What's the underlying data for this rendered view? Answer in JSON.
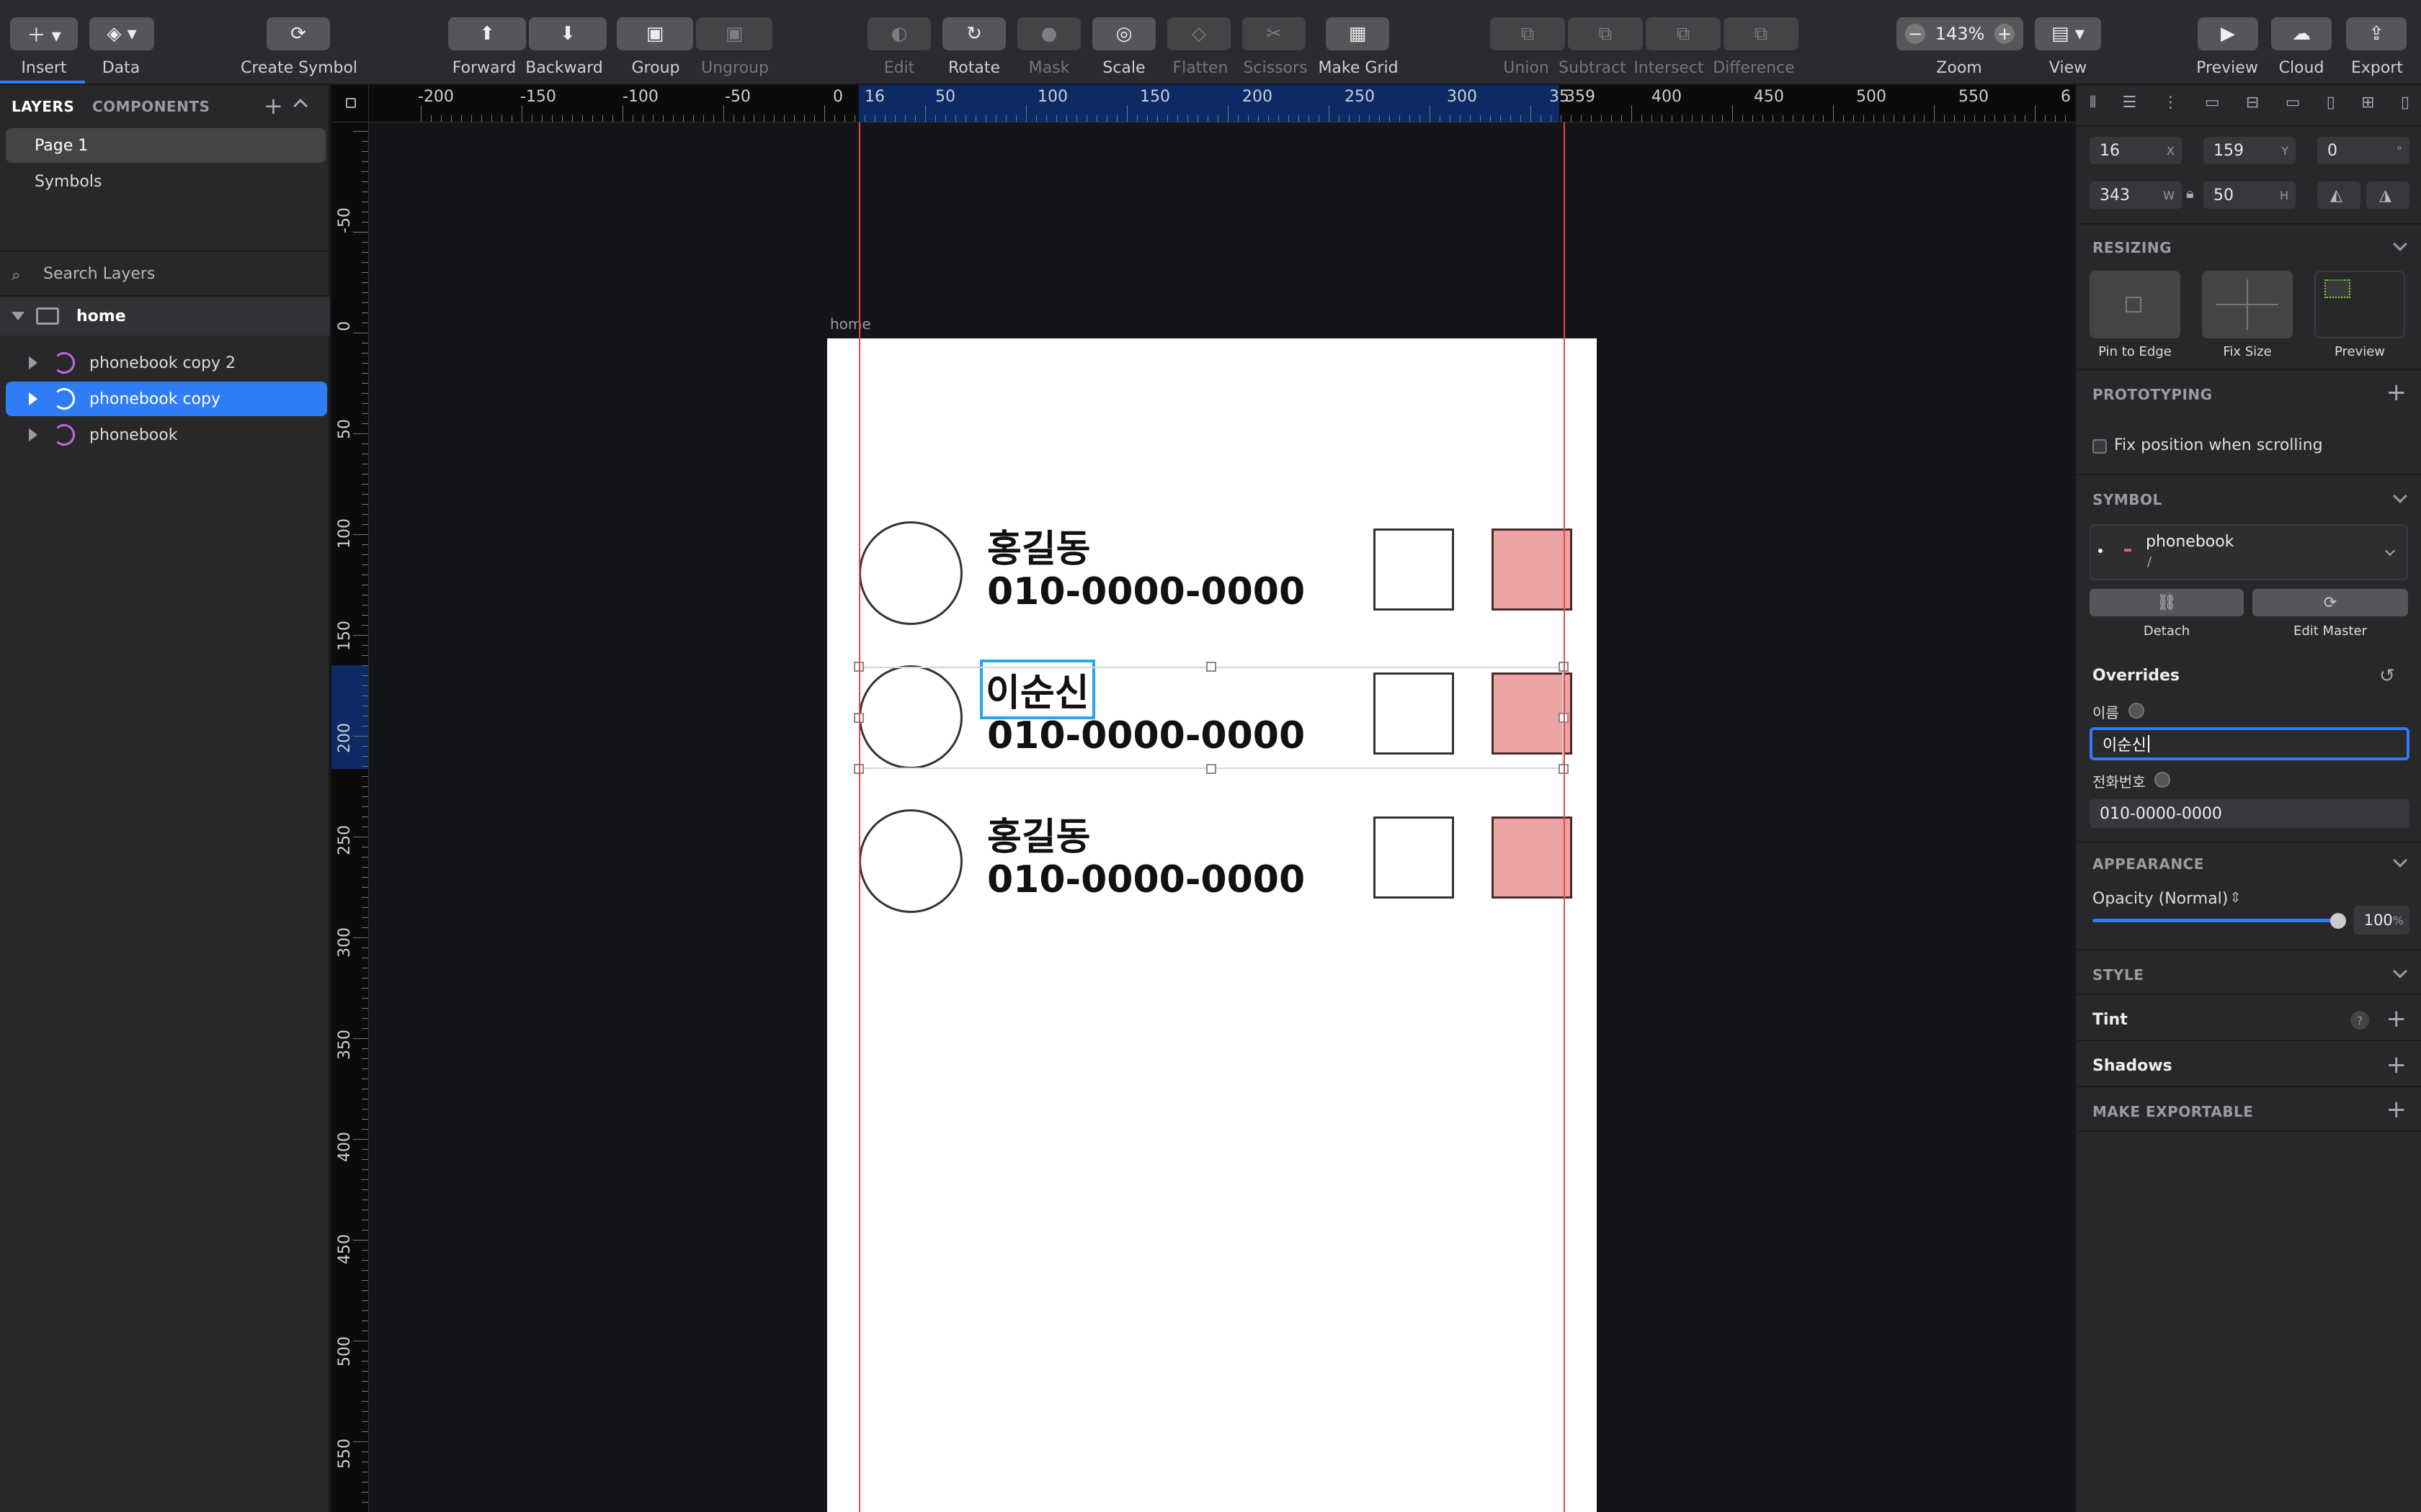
{
  "toolbar": {
    "insert": "Insert",
    "data": "Data",
    "create_symbol": "Create Symbol",
    "forward": "Forward",
    "backward": "Backward",
    "group": "Group",
    "ungroup": "Ungroup",
    "edit": "Edit",
    "rotate": "Rotate",
    "mask": "Mask",
    "scale": "Scale",
    "flatten": "Flatten",
    "scissors": "Scissors",
    "make_grid": "Make Grid",
    "union": "Union",
    "subtract": "Subtract",
    "intersect": "Intersect",
    "difference": "Difference",
    "zoom_value": "143%",
    "zoom": "Zoom",
    "view": "View",
    "preview": "Preview",
    "cloud": "Cloud",
    "export": "Export"
  },
  "left_panel": {
    "tab_layers": "LAYERS",
    "tab_components": "COMPONENTS",
    "pages": [
      "Page 1",
      "Symbols"
    ],
    "search_placeholder": "Search Layers",
    "artboard_name": "home",
    "layers": [
      "phonebook copy 2",
      "phonebook copy",
      "phonebook"
    ],
    "selected_layer": "phonebook copy"
  },
  "rulers": {
    "top": [
      "-200",
      "-150",
      "-100",
      "-50",
      "0",
      "16",
      "50",
      "100",
      "150",
      "200",
      "250",
      "300",
      "35",
      "359",
      "400",
      "450",
      "500",
      "550",
      "6"
    ],
    "left": [
      "-50",
      "0",
      "50",
      "100",
      "150",
      "200",
      "250",
      "300",
      "350",
      "400",
      "450",
      "500",
      "550"
    ]
  },
  "canvas": {
    "artboard_label": "home",
    "rows": [
      {
        "name": "홍길동",
        "phone": "010-0000-0000"
      },
      {
        "name": "이순신",
        "phone": "010-0000-0000"
      },
      {
        "name": "홍길동",
        "phone": "010-0000-0000"
      }
    ]
  },
  "inspector": {
    "x": "16",
    "x_unit": "X",
    "y": "159",
    "y_unit": "Y",
    "rotation": "0",
    "rotation_unit": "°",
    "w": "343",
    "w_unit": "W",
    "h": "50",
    "h_unit": "H",
    "resizing_title": "RESIZING",
    "pin_to_edge": "Pin to Edge",
    "fix_size": "Fix Size",
    "preview": "Preview",
    "prototyping_title": "PROTOTYPING",
    "fix_position": "Fix position when scrolling",
    "symbol_title": "SYMBOL",
    "symbol_name": "phonebook",
    "symbol_path": "/",
    "detach": "Detach",
    "edit_master": "Edit Master",
    "overrides_title": "Overrides",
    "override_name_label": "이름",
    "override_name_value": "이순신",
    "override_phone_label": "전화번호",
    "override_phone_value": "010-0000-0000",
    "appearance_title": "APPEARANCE",
    "opacity_label": "Opacity (Normal)",
    "opacity_value": "100",
    "opacity_unit": "%",
    "style_title": "STYLE",
    "tint": "Tint",
    "tint_help": "?",
    "shadows": "Shadows",
    "make_exportable": "MAKE EXPORTABLE"
  },
  "colors": {
    "selection_blue": "#2f7cf6",
    "guide_red": "#e24a4a",
    "pink_box": "#eba3a3"
  }
}
